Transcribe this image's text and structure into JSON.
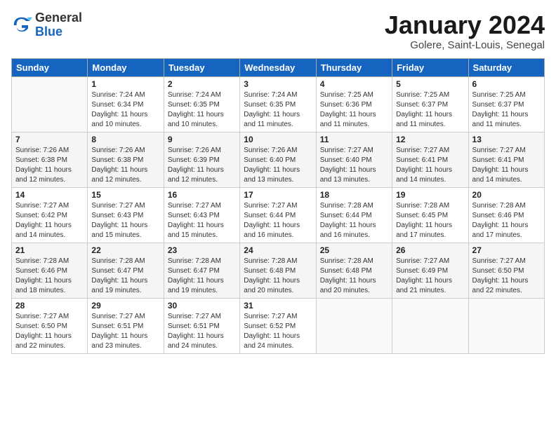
{
  "header": {
    "logo_general": "General",
    "logo_blue": "Blue",
    "month_title": "January 2024",
    "location": "Golere, Saint-Louis, Senegal"
  },
  "days_of_week": [
    "Sunday",
    "Monday",
    "Tuesday",
    "Wednesday",
    "Thursday",
    "Friday",
    "Saturday"
  ],
  "weeks": [
    [
      {
        "num": "",
        "info": ""
      },
      {
        "num": "1",
        "info": "Sunrise: 7:24 AM\nSunset: 6:34 PM\nDaylight: 11 hours\nand 10 minutes."
      },
      {
        "num": "2",
        "info": "Sunrise: 7:24 AM\nSunset: 6:35 PM\nDaylight: 11 hours\nand 10 minutes."
      },
      {
        "num": "3",
        "info": "Sunrise: 7:24 AM\nSunset: 6:35 PM\nDaylight: 11 hours\nand 11 minutes."
      },
      {
        "num": "4",
        "info": "Sunrise: 7:25 AM\nSunset: 6:36 PM\nDaylight: 11 hours\nand 11 minutes."
      },
      {
        "num": "5",
        "info": "Sunrise: 7:25 AM\nSunset: 6:37 PM\nDaylight: 11 hours\nand 11 minutes."
      },
      {
        "num": "6",
        "info": "Sunrise: 7:25 AM\nSunset: 6:37 PM\nDaylight: 11 hours\nand 11 minutes."
      }
    ],
    [
      {
        "num": "7",
        "info": "Sunrise: 7:26 AM\nSunset: 6:38 PM\nDaylight: 11 hours\nand 12 minutes."
      },
      {
        "num": "8",
        "info": "Sunrise: 7:26 AM\nSunset: 6:38 PM\nDaylight: 11 hours\nand 12 minutes."
      },
      {
        "num": "9",
        "info": "Sunrise: 7:26 AM\nSunset: 6:39 PM\nDaylight: 11 hours\nand 12 minutes."
      },
      {
        "num": "10",
        "info": "Sunrise: 7:26 AM\nSunset: 6:40 PM\nDaylight: 11 hours\nand 13 minutes."
      },
      {
        "num": "11",
        "info": "Sunrise: 7:27 AM\nSunset: 6:40 PM\nDaylight: 11 hours\nand 13 minutes."
      },
      {
        "num": "12",
        "info": "Sunrise: 7:27 AM\nSunset: 6:41 PM\nDaylight: 11 hours\nand 14 minutes."
      },
      {
        "num": "13",
        "info": "Sunrise: 7:27 AM\nSunset: 6:41 PM\nDaylight: 11 hours\nand 14 minutes."
      }
    ],
    [
      {
        "num": "14",
        "info": "Sunrise: 7:27 AM\nSunset: 6:42 PM\nDaylight: 11 hours\nand 14 minutes."
      },
      {
        "num": "15",
        "info": "Sunrise: 7:27 AM\nSunset: 6:43 PM\nDaylight: 11 hours\nand 15 minutes."
      },
      {
        "num": "16",
        "info": "Sunrise: 7:27 AM\nSunset: 6:43 PM\nDaylight: 11 hours\nand 15 minutes."
      },
      {
        "num": "17",
        "info": "Sunrise: 7:27 AM\nSunset: 6:44 PM\nDaylight: 11 hours\nand 16 minutes."
      },
      {
        "num": "18",
        "info": "Sunrise: 7:28 AM\nSunset: 6:44 PM\nDaylight: 11 hours\nand 16 minutes."
      },
      {
        "num": "19",
        "info": "Sunrise: 7:28 AM\nSunset: 6:45 PM\nDaylight: 11 hours\nand 17 minutes."
      },
      {
        "num": "20",
        "info": "Sunrise: 7:28 AM\nSunset: 6:46 PM\nDaylight: 11 hours\nand 17 minutes."
      }
    ],
    [
      {
        "num": "21",
        "info": "Sunrise: 7:28 AM\nSunset: 6:46 PM\nDaylight: 11 hours\nand 18 minutes."
      },
      {
        "num": "22",
        "info": "Sunrise: 7:28 AM\nSunset: 6:47 PM\nDaylight: 11 hours\nand 19 minutes."
      },
      {
        "num": "23",
        "info": "Sunrise: 7:28 AM\nSunset: 6:47 PM\nDaylight: 11 hours\nand 19 minutes."
      },
      {
        "num": "24",
        "info": "Sunrise: 7:28 AM\nSunset: 6:48 PM\nDaylight: 11 hours\nand 20 minutes."
      },
      {
        "num": "25",
        "info": "Sunrise: 7:28 AM\nSunset: 6:48 PM\nDaylight: 11 hours\nand 20 minutes."
      },
      {
        "num": "26",
        "info": "Sunrise: 7:27 AM\nSunset: 6:49 PM\nDaylight: 11 hours\nand 21 minutes."
      },
      {
        "num": "27",
        "info": "Sunrise: 7:27 AM\nSunset: 6:50 PM\nDaylight: 11 hours\nand 22 minutes."
      }
    ],
    [
      {
        "num": "28",
        "info": "Sunrise: 7:27 AM\nSunset: 6:50 PM\nDaylight: 11 hours\nand 22 minutes."
      },
      {
        "num": "29",
        "info": "Sunrise: 7:27 AM\nSunset: 6:51 PM\nDaylight: 11 hours\nand 23 minutes."
      },
      {
        "num": "30",
        "info": "Sunrise: 7:27 AM\nSunset: 6:51 PM\nDaylight: 11 hours\nand 24 minutes."
      },
      {
        "num": "31",
        "info": "Sunrise: 7:27 AM\nSunset: 6:52 PM\nDaylight: 11 hours\nand 24 minutes."
      },
      {
        "num": "",
        "info": ""
      },
      {
        "num": "",
        "info": ""
      },
      {
        "num": "",
        "info": ""
      }
    ]
  ]
}
